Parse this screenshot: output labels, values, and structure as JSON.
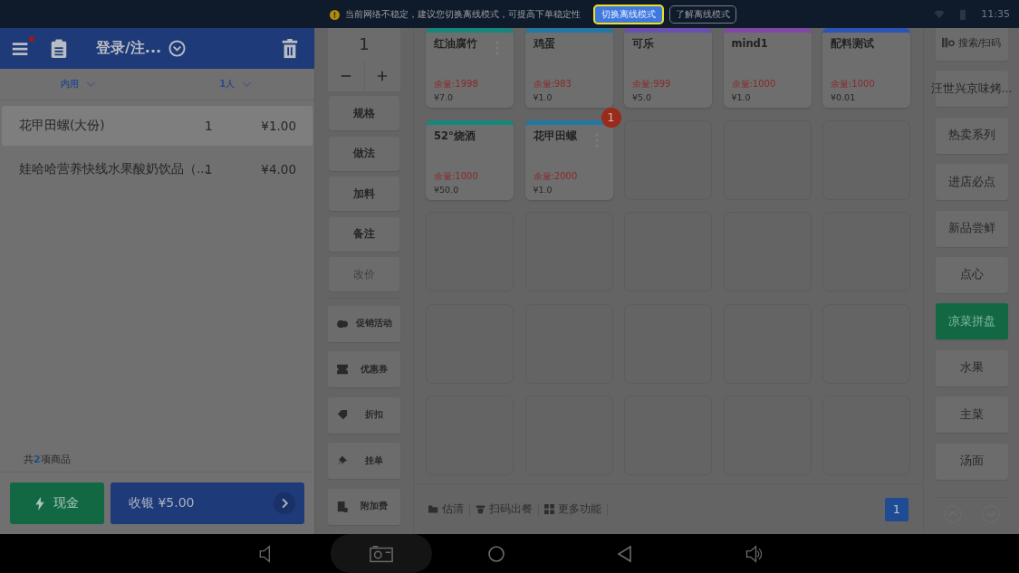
{
  "status_bar": {
    "time": "11:35"
  },
  "notice": {
    "text": "当前网络不稳定，建议您切换离线模式，可提高下单稳定性",
    "buttons": [
      {
        "label": "切换离线模式",
        "selected": true
      },
      {
        "label": "了解离线模式",
        "selected": false
      }
    ]
  },
  "order_header": {
    "title": "登录/注...",
    "menu_badge": true
  },
  "order_options": [
    {
      "label": "内用"
    },
    {
      "label": "1人"
    }
  ],
  "order_items": [
    {
      "name": "花甲田螺(大份)",
      "qty": "1",
      "price": "¥1.00",
      "selected": true
    },
    {
      "name": "娃哈哈营养快线水果酸奶饮品（...",
      "qty": "1",
      "price": "¥4.00",
      "selected": false
    }
  ],
  "summary": "共**2**项商品",
  "pay_buttons": {
    "cash": "现金",
    "checkout": "收银 ¥5.00"
  },
  "quantity": "1",
  "actions": [
    {
      "label": "规格",
      "kind": "plain",
      "disabled": false
    },
    {
      "label": "做法",
      "kind": "plain",
      "disabled": false
    },
    {
      "label": "加料",
      "kind": "plain",
      "disabled": false
    },
    {
      "label": "备注",
      "kind": "plain",
      "disabled": false
    },
    {
      "label": "改价",
      "kind": "plain",
      "disabled": true
    },
    {
      "label": "促销活动",
      "kind": "promo",
      "disabled": false
    },
    {
      "label": "优惠券",
      "kind": "coupon",
      "disabled": false
    },
    {
      "label": "折扣",
      "kind": "discount",
      "disabled": false
    },
    {
      "label": "挂单",
      "kind": "hold",
      "disabled": false
    },
    {
      "label": "附加费",
      "kind": "surcharge",
      "disabled": false
    }
  ],
  "products": [
    {
      "name": "红油腐竹",
      "stock": "余量:1998",
      "price": "¥7.0",
      "color": "#17877d",
      "more": true
    },
    {
      "name": "鸡蛋",
      "stock": "余量:983",
      "price": "¥1.0",
      "color": "#2377a3",
      "more": false
    },
    {
      "name": "可乐",
      "stock": "余量:999",
      "price": "¥5.0",
      "color": "#6a4fb0",
      "more": false
    },
    {
      "name": "mind1",
      "stock": "余量:1000",
      "price": "¥1.0",
      "color": "#8047a8",
      "more": false
    },
    {
      "name": "配料测试",
      "stock": "余量:1000",
      "price": "¥0.01",
      "color": "#2a55b5",
      "more": false
    },
    {
      "name": "52°烧酒",
      "stock": "余量:1000",
      "price": "¥50.0",
      "color": "#17877d",
      "more": false
    },
    {
      "name": "花甲田螺",
      "stock": "余量:2000",
      "price": "¥1.0",
      "color": "#2377a3",
      "more": true,
      "badge": "1"
    }
  ],
  "toolbar": [
    {
      "label": "估清",
      "kind": "folder"
    },
    {
      "label": "扫码出餐",
      "kind": "serve"
    },
    {
      "label": "更多功能",
      "kind": "grid"
    }
  ],
  "page": "1",
  "categories": [
    {
      "label": "搜索/扫码",
      "kind": "search",
      "selected": false
    },
    {
      "label": "汪世兴京味烤...",
      "kind": "plain",
      "selected": false
    },
    {
      "label": "热卖系列",
      "kind": "plain",
      "selected": false
    },
    {
      "label": "进店必点",
      "kind": "plain",
      "selected": false
    },
    {
      "label": "新品尝鲜",
      "kind": "plain",
      "selected": false
    },
    {
      "label": "点心",
      "kind": "plain",
      "selected": false
    },
    {
      "label": "凉菜拼盘",
      "kind": "plain",
      "selected": true
    },
    {
      "label": "水果",
      "kind": "plain",
      "selected": false
    },
    {
      "label": "主菜",
      "kind": "plain",
      "selected": false
    },
    {
      "label": "汤面",
      "kind": "plain",
      "selected": false
    }
  ]
}
